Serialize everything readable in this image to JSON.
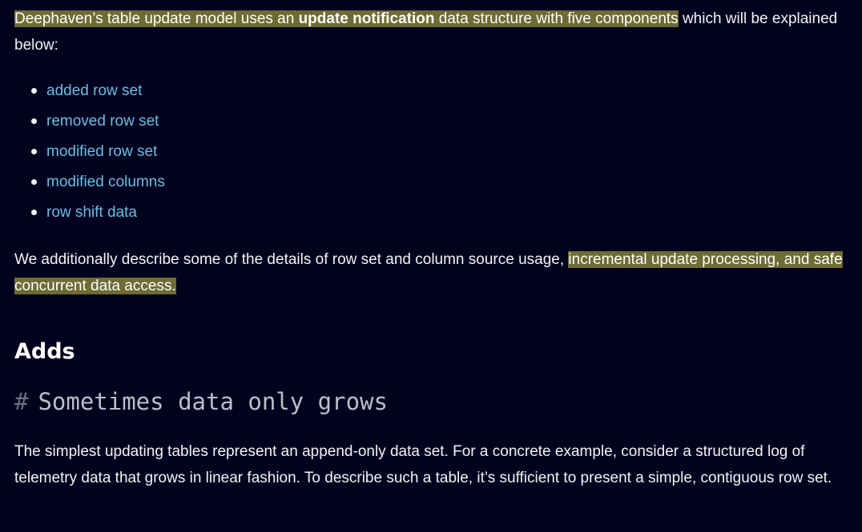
{
  "intro": {
    "highlight_before": "Deephaven’s table update model uses an ",
    "bold_term": "update notification",
    "highlight_after": " data structure with five components",
    "rest": " which will be explained below:"
  },
  "components": [
    {
      "label": "added row set"
    },
    {
      "label": "removed row set"
    },
    {
      "label": "modified row set"
    },
    {
      "label": "modified columns"
    },
    {
      "label": "row shift data"
    }
  ],
  "detail": {
    "plain": "We additionally describe some of the details of row set and column source usage, ",
    "highlight": "incremental update processing, and safe concurrent data access."
  },
  "section": {
    "heading": "Adds",
    "subheading_hash": "#",
    "subheading": "Sometimes data only grows",
    "paragraph": "The simplest updating tables represent an append-only data set. For a concrete example, consider a structured log of telemetry data that grows in linear fashion. To describe such a table, it’s sufficient to present a simple, contiguous row set."
  },
  "colors": {
    "background": "#02021f",
    "highlight": "#6e6b34",
    "link": "#6dbde0",
    "text": "#f3f3f3"
  }
}
